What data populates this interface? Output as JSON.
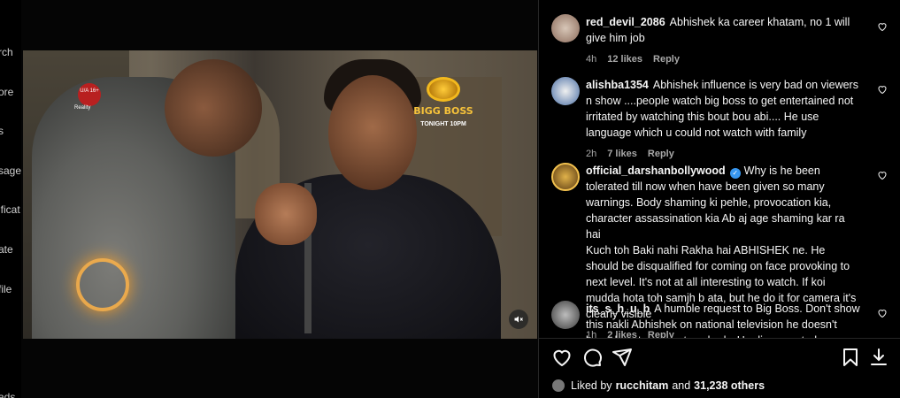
{
  "sidebar": {
    "items": [
      "rch",
      "ore",
      "s",
      "sage",
      "ificat",
      "ate",
      "file",
      "ads"
    ]
  },
  "video": {
    "rating_badge": "U/A 16+",
    "genre_badge": "Reality",
    "show_title": "BIGG BOSS",
    "show_time": "TONIGHT 10PM",
    "muted": true
  },
  "comments": [
    {
      "username": "red_devil_2086",
      "verified": false,
      "text": "Abhishek ka career khatam, no 1 will give him job",
      "time": "4h",
      "likes": "12 likes",
      "reply_label": "Reply"
    },
    {
      "username": "alishba1354",
      "verified": false,
      "text": "Abhishek influence is very bad on viewers n show ....people watch big boss to get entertained not irritated by watching this bout bou abi.... He use language which u could not watch with family",
      "time": "2h",
      "likes": "7 likes",
      "reply_label": "Reply"
    },
    {
      "username": "official_darshanbollywood",
      "verified": true,
      "text": "Why is he been tolerated till now when have been given so many warnings. Body shaming ki pehle, provocation kia, character assassination kia Ab aj age shaming kar ra hai",
      "text2": "Kuch toh Baki nahi Rakha hai ABHISHEK ne. He should be disqualified for coming on face provoking to next level. It's not at all interesting to watch. If koi mudda hota toh samjh b ata, but he do it for camera it's clearly visible",
      "time": "1h",
      "likes": "2 likes",
      "reply_label": "Reply"
    },
    {
      "username": "its_s_h_u_b",
      "verified": false,
      "text": "A humble request to Big Boss. Don't show this nakli Abhishek on national television he doesn't know how to respect anybody. He disrespected khanzadi and Isha and then",
      "time": "",
      "likes": "",
      "reply_label": ""
    }
  ],
  "likes_bar": {
    "prefix": "Liked by",
    "user": "rucchitam",
    "conj": "and",
    "others": "31,238 others"
  },
  "icons": [
    "heart-icon",
    "comment-icon",
    "share-icon",
    "bookmark-icon",
    "download-icon",
    "speaker-muted-icon"
  ],
  "colors": {
    "accent": "#3897f0",
    "secondary_text": "#a8a8a8",
    "divider": "#262626"
  }
}
